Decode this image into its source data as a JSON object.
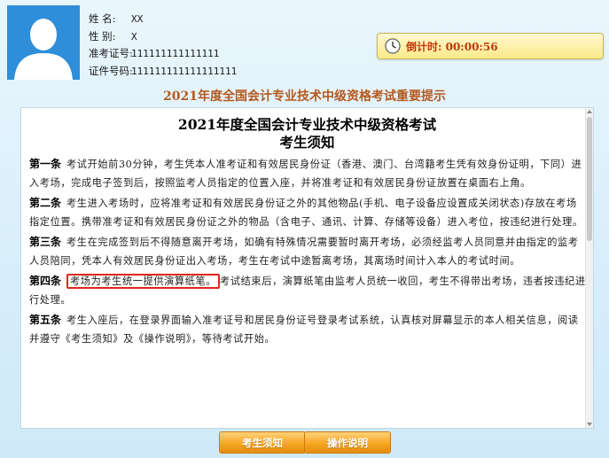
{
  "candidate": {
    "name_label": "姓 名:",
    "name_value": "XX",
    "gender_label": "性 别:",
    "gender_value": "X",
    "ticket_label": "准考证号:",
    "ticket_value": "111111111111111",
    "id_label": "证件号码:",
    "id_value": "111111111111111111"
  },
  "timer": {
    "label": "倒计时: 00:00:56",
    "icon": "clock-icon"
  },
  "banner": "2021年度全国会计专业技术中级资格考试重要提示",
  "document": {
    "title": "2021年度全国会计专业技术中级资格考试",
    "subtitle": "考生须知",
    "articles": [
      {
        "head": "第一条",
        "text": "考试开始前30分钟，考生凭本人准考证和有效居民身份证（香港、澳门、台湾籍考生凭有效身份证明，下同）进入考场，完成电子签到后，按照监考人员指定的位置入座，并将准考证和有效居民身份证放置在桌面右上角。"
      },
      {
        "head": "第二条",
        "text": "考生进入考场时，应将准考证和有效居民身份证之外的其他物品(手机、电子设备应设置成关闭状态)存放在考场指定位置。携带准考证和有效居民身份证之外的物品（含电子、通讯、计算、存储等设备）进入考位，按违纪进行处理。"
      },
      {
        "head": "第三条",
        "text": "考生在完成签到后不得随意离开考场，如确有特殊情况需要暂时离开考场，必须经监考人员同意并由指定的监考人员陪同，凭本人有效居民身份证出入考场，考生在考试中途暂离考场，其离场时间计入本人的考试时间。"
      },
      {
        "head": "第四条",
        "highlight": "考场为考生统一提供演算纸笔。",
        "text": "考试结束后，演算纸笔由监考人员统一收回，考生不得带出考场，违者按违纪进行处理。"
      },
      {
        "head": "第五条",
        "text": "考生入座后，在登录界面输入准考证号和居民身份证号登录考试系统，认真核对屏幕显示的本人相关信息，阅读并遵守《考生须知》及《操作说明》，等待考试开始。"
      }
    ]
  },
  "buttons": {
    "notice_label": "考生须知",
    "instructions_label": "操作说明"
  },
  "colors": {
    "button_orange": "#f6a623",
    "highlight_red": "#e0261c",
    "timer_text": "#c0390a",
    "banner_text": "#b4591f",
    "avatar_blue": "#2f8ed9"
  }
}
